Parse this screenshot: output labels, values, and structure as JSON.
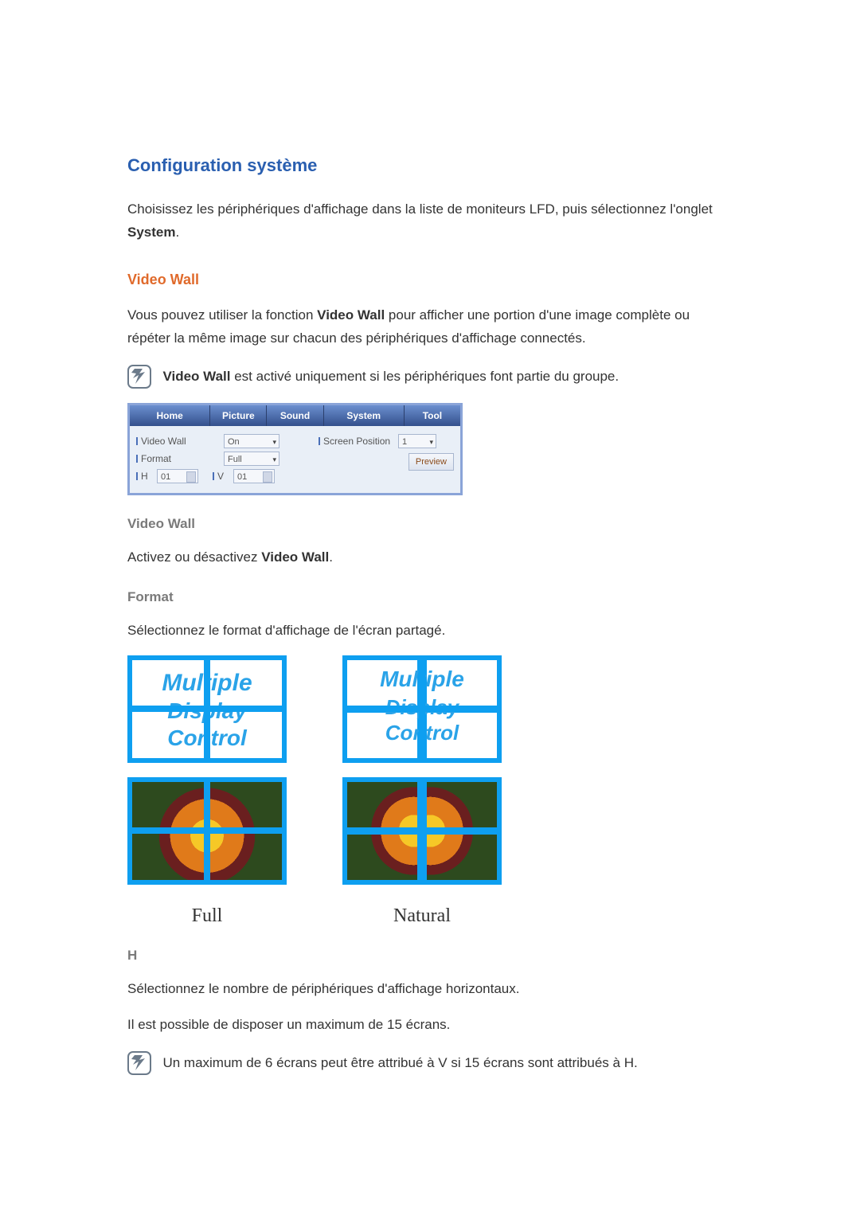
{
  "section_title": "Configuration système",
  "intro_part1": "Choisissez les périphériques d'affichage dans la liste de moniteurs LFD, puis sélectionnez l'onglet ",
  "intro_bold": "System",
  "intro_part2": ".",
  "video_wall_heading": "Video Wall",
  "video_wall_desc_part1": "Vous pouvez utiliser la fonction ",
  "video_wall_desc_bold": "Video Wall",
  "video_wall_desc_part2": " pour afficher une portion d'une image complète ou répéter la même image sur chacun des périphériques d'affichage connectés.",
  "note1_prefix_bold": "Video Wall",
  "note1_rest": " est activé uniquement si les périphériques font partie du groupe.",
  "ui": {
    "tabs": [
      "Home",
      "Picture",
      "Sound",
      "System",
      "Tool"
    ],
    "video_wall_label": "Video Wall",
    "video_wall_value": "On",
    "screen_pos_label": "Screen Position",
    "screen_pos_value": "1",
    "format_label": "Format",
    "format_value": "Full",
    "preview_btn": "Preview",
    "h_label": "H",
    "h_value": "01",
    "v_label": "V",
    "v_value": "01"
  },
  "vw_sub_heading": "Video Wall",
  "vw_sub_desc_part1": "Activez ou désactivez ",
  "vw_sub_desc_bold": "Video Wall",
  "vw_sub_desc_part2": ".",
  "format_heading": "Format",
  "format_desc": "Sélectionnez le format d'affichage de l'écran partagé.",
  "mdc_text_line1": "Multiple",
  "mdc_text_line2": "Display",
  "mdc_text_line3": "Control",
  "format_label_full": "Full",
  "format_label_natural": "Natural",
  "h_heading": "H",
  "h_desc": "Sélectionnez le nombre de périphériques d'affichage horizontaux.",
  "h_desc2": "Il est possible de disposer un maximum de 15 écrans.",
  "note2": "Un maximum de 6 écrans peut être attribué à V si 15 écrans sont attribués à H."
}
